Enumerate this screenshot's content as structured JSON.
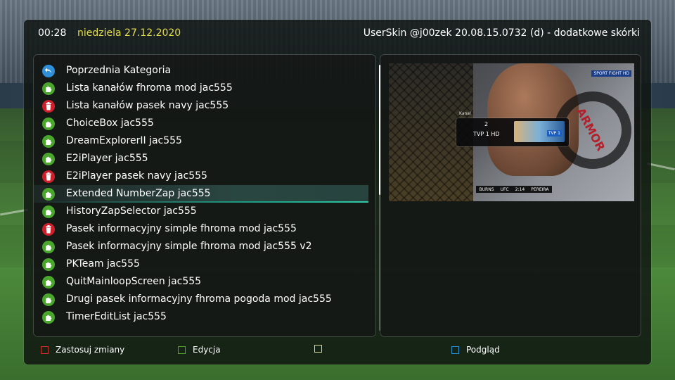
{
  "topbar": {
    "clock": "00:28",
    "date": "niedziela 27.12.2020",
    "skin_title": "UserSkin @j00zek 20.08.15.0732 (d) - dodatkowe skórki"
  },
  "menu": {
    "items": [
      {
        "label": "Poprzednia Kategoria",
        "icon": "back-arrow-icon"
      },
      {
        "label": "Lista kanałów fhroma mod jac555",
        "icon": "puzzle-icon"
      },
      {
        "label": "Lista kanałów pasek navy jac555",
        "icon": "trash-icon"
      },
      {
        "label": "ChoiceBox jac555",
        "icon": "puzzle-icon"
      },
      {
        "label": "DreamExplorerII jac555",
        "icon": "puzzle-icon"
      },
      {
        "label": "E2iPlayer jac555",
        "icon": "puzzle-icon"
      },
      {
        "label": "E2iPlayer pasek navy jac555",
        "icon": "trash-icon"
      },
      {
        "label": "Extended NumberZap jac555",
        "icon": "puzzle-icon",
        "selected": true
      },
      {
        "label": "HistoryZapSelector jac555",
        "icon": "puzzle-icon"
      },
      {
        "label": "Pasek informacyjny simple fhroma mod jac555",
        "icon": "trash-icon"
      },
      {
        "label": "Pasek informacyjny simple fhroma mod jac555 v2",
        "icon": "puzzle-icon"
      },
      {
        "label": "PKTeam jac555",
        "icon": "puzzle-icon"
      },
      {
        "label": "QuitMainloopScreen jac555",
        "icon": "puzzle-icon"
      },
      {
        "label": "Drugi pasek informacyjny fhroma pogoda mod jac555",
        "icon": "puzzle-icon"
      },
      {
        "label": "TimerEditList jac555",
        "icon": "puzzle-icon"
      }
    ]
  },
  "preview": {
    "numberzap_caption": "Kanał",
    "channel_number": "2",
    "channel_name": "TVP 1 HD",
    "channel_logo": "TVP 1",
    "sport_badge": "SPORT FIGHT HD",
    "score_left": "BURNS",
    "score_logo": "UFC",
    "score_time": "2:14",
    "score_right": "PEREIRA",
    "mat_text": "ARMOR"
  },
  "hints": {
    "red": "Zastosuj zmiany",
    "green": "Edycja",
    "yellow": "",
    "blue": "Podgląd"
  },
  "colors": {
    "date_yellow": "#e4dc4f",
    "red_key": "#c9372c",
    "green_key": "#4aa62c",
    "yellow_key": "#d7d7a0",
    "blue_key": "#2e8fd0",
    "selection_accent": "#30c9a8"
  }
}
